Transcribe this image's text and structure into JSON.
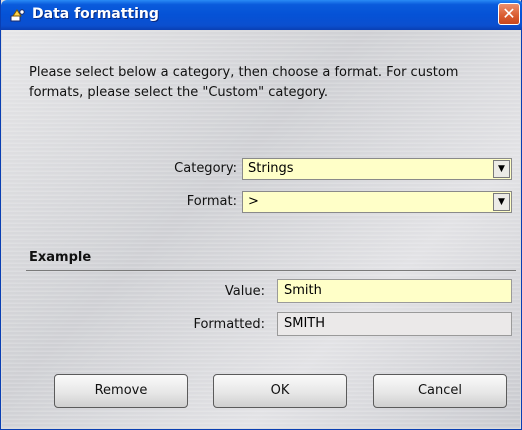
{
  "window": {
    "title": "Data formatting",
    "close_label": "✕"
  },
  "instructions": "Please select below a category, then choose a format. For custom formats, please select the \"Custom\" category.",
  "form": {
    "category_label": "Category:",
    "category_value": "Strings",
    "format_label": "Format:",
    "format_value": ">"
  },
  "example": {
    "section_title": "Example",
    "value_label": "Value:",
    "value": "Smith",
    "formatted_label": "Formatted:",
    "formatted_value": "SMITH"
  },
  "buttons": {
    "remove": "Remove",
    "ok": "OK",
    "cancel": "Cancel"
  },
  "icons": {
    "title": "format-icon",
    "dropdown": "chevron-down-icon",
    "close": "close-icon"
  },
  "colors": {
    "titlebar": "#0552d6",
    "input_bg": "#ffffc8",
    "readonly_bg": "#ebe9e9"
  }
}
